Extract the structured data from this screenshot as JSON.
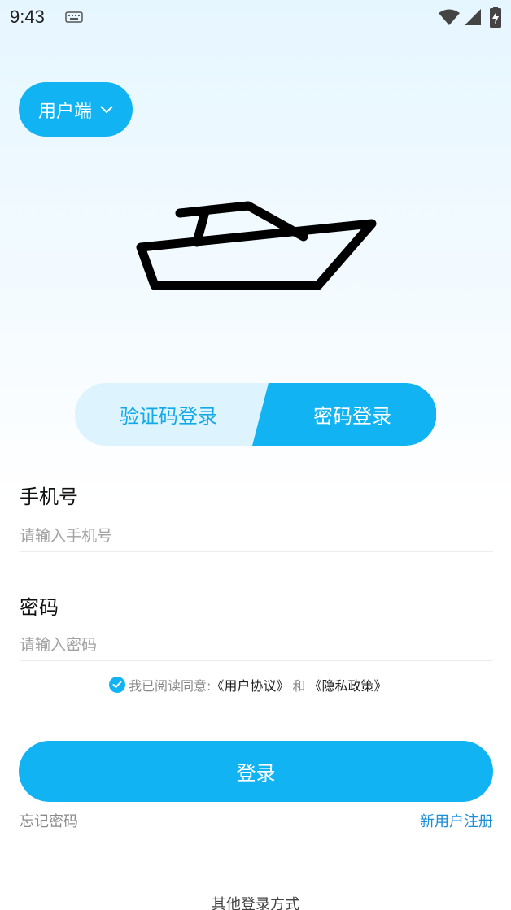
{
  "status_bar": {
    "time": "9:43",
    "icons": [
      "keyboard-icon",
      "wifi-icon",
      "signal-icon",
      "battery-charging-icon"
    ]
  },
  "role_selector": {
    "label": "用户端",
    "icon": "chevron-down-icon"
  },
  "logo": {
    "icon": "boat-icon"
  },
  "tabs": [
    {
      "label": "验证码登录",
      "active": false
    },
    {
      "label": "密码登录",
      "active": true
    }
  ],
  "phone": {
    "label": "手机号",
    "placeholder": "请输入手机号",
    "value": ""
  },
  "password": {
    "label": "密码",
    "placeholder": "请输入密码",
    "value": ""
  },
  "agreement": {
    "checked": true,
    "prefix": "我已阅读同意:",
    "user_agreement": "《用户协议》",
    "and": "和",
    "privacy_policy": "《隐私政策》"
  },
  "login_button": {
    "label": "登录"
  },
  "forgot_password": "忘记密码",
  "register": "新用户注册",
  "other_login": "其他登录方式",
  "colors": {
    "accent": "#12b3f3",
    "tab_inactive_bg": "#ddf3fd",
    "link": "#1a8ed8"
  }
}
